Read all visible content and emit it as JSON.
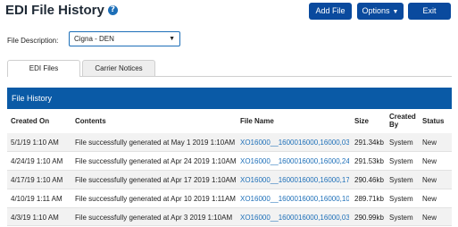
{
  "header": {
    "title": "EDI File History",
    "help_icon": "?",
    "buttons": {
      "add": "Add File",
      "options": "Options",
      "exit": "Exit"
    }
  },
  "filters": {
    "description_label": "File Description:",
    "description_value": "Cigna - DEN"
  },
  "tabs": [
    {
      "label": "EDI Files",
      "active": true
    },
    {
      "label": "Carrier Notices",
      "active": false
    }
  ],
  "panel": {
    "title": "File History",
    "columns": {
      "created_on": "Created On",
      "contents": "Contents",
      "file_name": "File Name",
      "size": "Size",
      "created_by": "Created By",
      "status": "Status"
    },
    "rows": [
      {
        "created_on": "5/1/19 1:10 AM",
        "contents": "File successfully generated at May 1 2019 1:10AM",
        "file_name": "XO16000__1600016000,16000,03...",
        "size": "291.34kb",
        "created_by": "System",
        "status": "New"
      },
      {
        "created_on": "4/24/19 1:10 AM",
        "contents": "File successfully generated at Apr 24 2019 1:10AM",
        "file_name": "XO16000__1600016000,16000,24...",
        "size": "291.53kb",
        "created_by": "System",
        "status": "New"
      },
      {
        "created_on": "4/17/19 1:10 AM",
        "contents": "File successfully generated at Apr 17 2019 1:10AM",
        "file_name": "XO16000__1600016000,16000,17...",
        "size": "290.46kb",
        "created_by": "System",
        "status": "New"
      },
      {
        "created_on": "4/10/19 1:11 AM",
        "contents": "File successfully generated at Apr 10 2019 1:11AM",
        "file_name": "XO16000__1600016000,16000,10...",
        "size": "289.71kb",
        "created_by": "System",
        "status": "New"
      },
      {
        "created_on": "4/3/19 1:10 AM",
        "contents": "File successfully generated at Apr 3 2019 1:10AM",
        "file_name": "XO16000__1600016000,16000,03...",
        "size": "290.99kb",
        "created_by": "System",
        "status": "New"
      }
    ]
  },
  "colors": {
    "primary": "#0a4a9e",
    "header_bar": "#0a5aa6",
    "link": "#1d6fb8"
  }
}
